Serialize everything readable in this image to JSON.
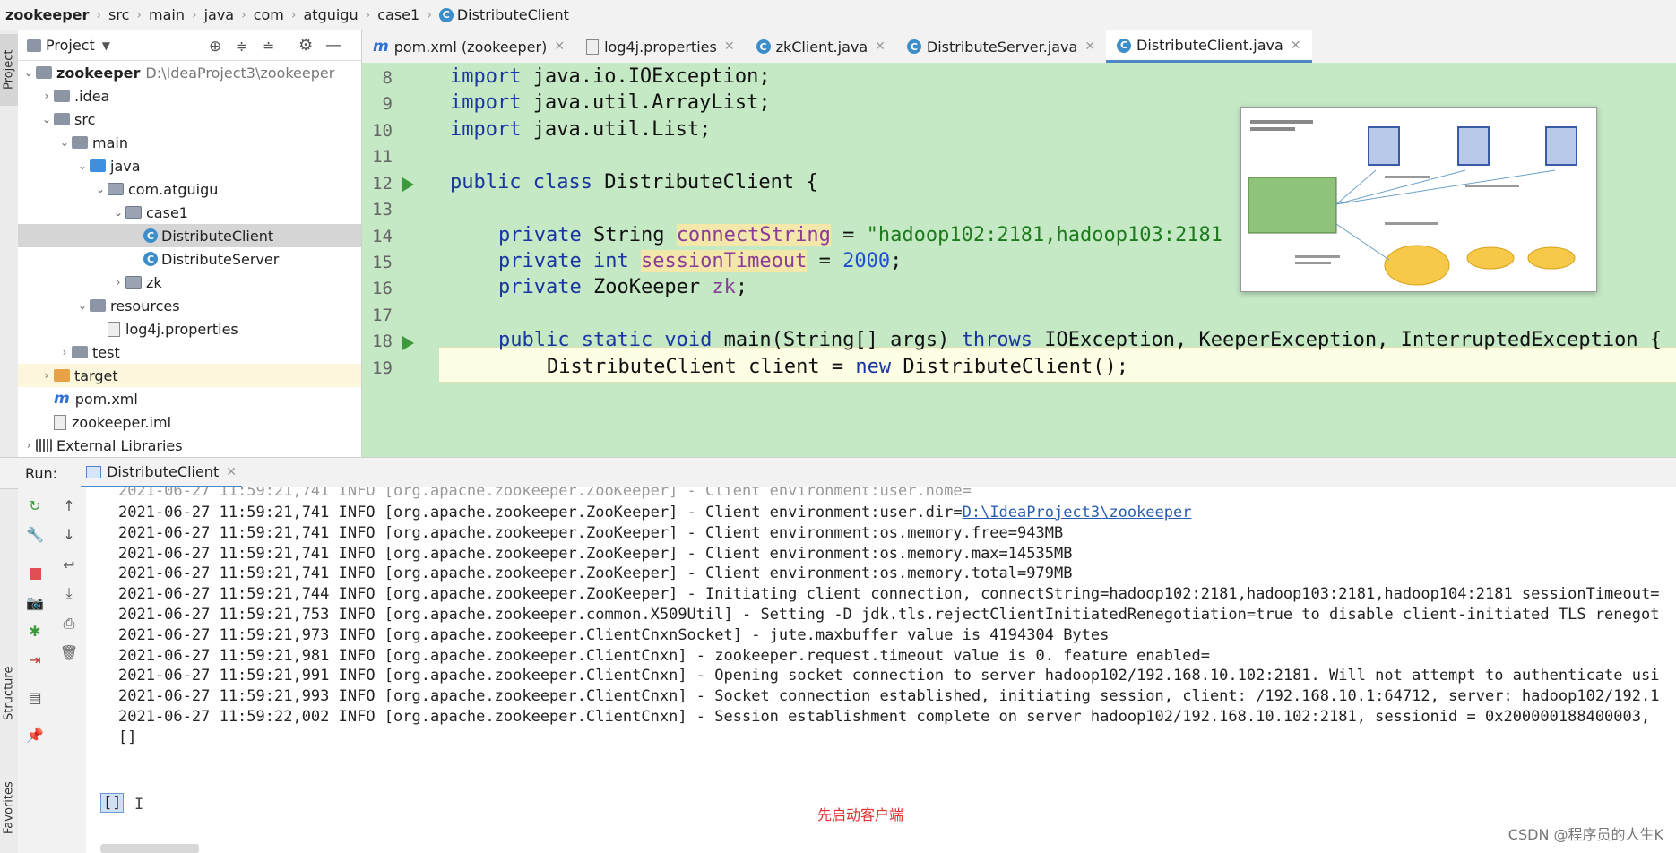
{
  "breadcrumb": [
    "zookeeper",
    "src",
    "main",
    "java",
    "com",
    "atguigu",
    "case1",
    "DistributeClient"
  ],
  "side_tabs": {
    "project": "Project",
    "structure": "Structure",
    "favorites": "Favorites"
  },
  "project_panel": {
    "title": "Project",
    "tree": [
      {
        "label": "zookeeper",
        "hint": "D:\\IdeaProject3\\zookeeper",
        "depth": 0,
        "arrow": "down",
        "icon": "module"
      },
      {
        "label": ".idea",
        "depth": 1,
        "arrow": "right",
        "icon": "folder"
      },
      {
        "label": "src",
        "depth": 1,
        "arrow": "down",
        "icon": "folder"
      },
      {
        "label": "main",
        "depth": 2,
        "arrow": "down",
        "icon": "folder"
      },
      {
        "label": "java",
        "depth": 3,
        "arrow": "down",
        "icon": "folder-blue"
      },
      {
        "label": "com.atguigu",
        "depth": 4,
        "arrow": "down",
        "icon": "package"
      },
      {
        "label": "case1",
        "depth": 5,
        "arrow": "down",
        "icon": "package"
      },
      {
        "label": "DistributeClient",
        "depth": 6,
        "arrow": "",
        "icon": "class",
        "selected": true
      },
      {
        "label": "DistributeServer",
        "depth": 6,
        "arrow": "",
        "icon": "class"
      },
      {
        "label": "zk",
        "depth": 5,
        "arrow": "right",
        "icon": "package"
      },
      {
        "label": "resources",
        "depth": 3,
        "arrow": "down",
        "icon": "folder"
      },
      {
        "label": "log4j.properties",
        "depth": 4,
        "arrow": "",
        "icon": "file"
      },
      {
        "label": "test",
        "depth": 2,
        "arrow": "right",
        "icon": "folder"
      },
      {
        "label": "target",
        "depth": 1,
        "arrow": "right",
        "icon": "folder-orange",
        "highlight": true
      },
      {
        "label": "pom.xml",
        "depth": 1,
        "arrow": "",
        "icon": "maven"
      },
      {
        "label": "zookeeper.iml",
        "depth": 1,
        "arrow": "",
        "icon": "file"
      },
      {
        "label": "External Libraries",
        "depth": 0,
        "arrow": "right",
        "icon": "library"
      }
    ]
  },
  "tabs": [
    {
      "label": "pom.xml (zookeeper)",
      "icon": "m"
    },
    {
      "label": "log4j.properties",
      "icon": "file"
    },
    {
      "label": "zkClient.java",
      "icon": "class"
    },
    {
      "label": "DistributeServer.java",
      "icon": "class"
    },
    {
      "label": "DistributeClient.java",
      "icon": "class",
      "active": true
    }
  ],
  "editor": {
    "line_numbers": [
      "8",
      "9",
      "10",
      "11",
      "12",
      "13",
      "14",
      "15",
      "16",
      "17",
      "18",
      "19"
    ],
    "line_imp1_kw": "import",
    "line_imp1_rest": " java.io.IOException;",
    "line_imp2_kw": "import",
    "line_imp2_rest": " java.util.ArrayList;",
    "line_imp3_kw": "import",
    "line_imp3_rest": " java.util.List;",
    "class_kw": "public class",
    "class_name": " DistributeClient {",
    "f1_kw": "private",
    "f1_type": " String ",
    "f1_name": "connectString",
    "f1_eq": " = ",
    "f1_val": "\"hadoop102:2181,hadoop103:2181",
    "f2_kw": "private int",
    "f2_name": "sessionTimeout",
    "f2_eq": " = ",
    "f2_val": "2000",
    "f2_end": ";",
    "f3_kw": "private",
    "f3_type": " ZooKeeper ",
    "f3_name": "zk",
    "f3_end": ";",
    "main_kw": "public static void",
    "main_sig": " main(String[] args) ",
    "main_throws": "throws",
    "main_exc": " IOException, KeeperException, InterruptedException {",
    "body_a": "DistributeClient client = ",
    "body_kw": "new",
    "body_b": " DistributeClient();"
  },
  "run": {
    "label": "Run:",
    "tab": "DistributeClient",
    "logs": [
      {
        "text": "2021-06-27 11:59:21,741 INFO [org.apache.zookeeper.ZooKeeper] - Client environment:user.dir=",
        "link": "D:\\IdeaProject3\\zookeeper"
      },
      {
        "text": "2021-06-27 11:59:21,741 INFO [org.apache.zookeeper.ZooKeeper] - Client environment:os.memory.free=943MB"
      },
      {
        "text": "2021-06-27 11:59:21,741 INFO [org.apache.zookeeper.ZooKeeper] - Client environment:os.memory.max=14535MB"
      },
      {
        "text": "2021-06-27 11:59:21,741 INFO [org.apache.zookeeper.ZooKeeper] - Client environment:os.memory.total=979MB"
      },
      {
        "text": "2021-06-27 11:59:21,744 INFO [org.apache.zookeeper.ZooKeeper] - Initiating client connection, connectString=hadoop102:2181,hadoop103:2181,hadoop104:2181 sessionTimeout="
      },
      {
        "text": "2021-06-27 11:59:21,753 INFO [org.apache.zookeeper.common.X509Util] - Setting -D jdk.tls.rejectClientInitiatedRenegotiation=true to disable client-initiated TLS renegot"
      },
      {
        "text": "2021-06-27 11:59:21,973 INFO [org.apache.zookeeper.ClientCnxnSocket] - jute.maxbuffer value is 4194304 Bytes"
      },
      {
        "text": "2021-06-27 11:59:21,981 INFO [org.apache.zookeeper.ClientCnxn] - zookeeper.request.timeout value is 0. feature enabled="
      },
      {
        "text": "2021-06-27 11:59:21,991 INFO [org.apache.zookeeper.ClientCnxn] - Opening socket connection to server hadoop102/192.168.10.102:2181. Will not attempt to authenticate usi"
      },
      {
        "text": "2021-06-27 11:59:21,993 INFO [org.apache.zookeeper.ClientCnxn] - Socket connection established, initiating session, client: /192.168.10.1:64712, server: hadoop102/192.1"
      },
      {
        "text": "2021-06-27 11:59:22,002 INFO [org.apache.zookeeper.ClientCnxn] - Session establishment complete on server hadoop102/192.168.10.102:2181, sessionid = 0x200000188400003,"
      },
      {
        "text": "[]"
      }
    ],
    "last_output": "[]",
    "note": "先启动客户端"
  },
  "watermark": "CSDN @程序员的人生K"
}
